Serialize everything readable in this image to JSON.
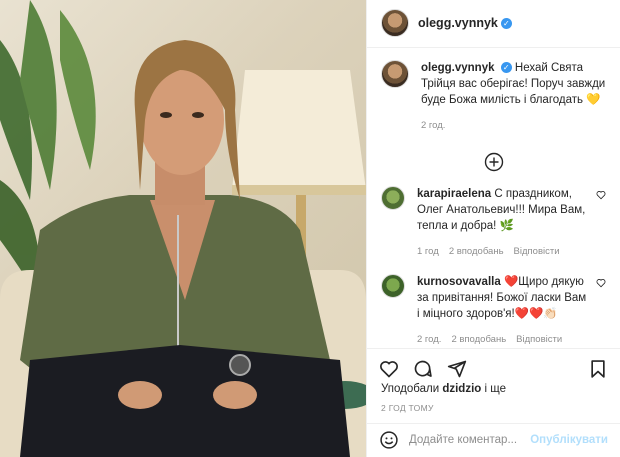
{
  "post": {
    "author": "olegg.vynnyk",
    "caption": "Нехай Свята Трійця вас оберігає! Поруч завжди буде Божа милість і благодать",
    "caption_emoji": "💛",
    "caption_time": "2 год."
  },
  "comments": [
    {
      "user": "karapiraelena",
      "text": "С праздником, Олег Анатольевич!!! Мира Вам, тепла и добра! 🌿",
      "time": "1 год",
      "likes": "2 вподобань",
      "reply": "Відповісти"
    },
    {
      "user": "kurnosovavalla",
      "text": "❤️Щиро дякую за привітання! Божої ласки Вам і міцного здоров'я!❤️❤️👏🏻",
      "time": "2 год.",
      "likes": "2 вподобань",
      "reply": "Відповісти"
    }
  ],
  "likes": {
    "prefix": "Уподобали ",
    "user": "dzidzio",
    "suffix": " і ще"
  },
  "timestamp": "2 ГОД ТОМУ",
  "add_comment": {
    "placeholder": "Додайте коментар...",
    "publish": "Опублікувати"
  },
  "colors": {
    "verified": "#3897f0",
    "text": "#262626",
    "muted": "#8e8e8e",
    "publish_disabled": "#b2dffc",
    "jacket": "#5f6b45"
  },
  "icons": [
    "heart-icon",
    "comment-icon",
    "share-icon",
    "bookmark-icon",
    "emoji-icon",
    "plus-circle-icon",
    "verified-icon"
  ]
}
